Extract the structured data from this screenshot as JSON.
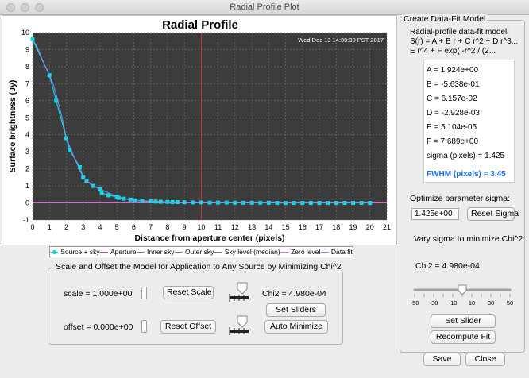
{
  "window": {
    "title": "Radial Profile Plot"
  },
  "chart_data": {
    "type": "scatter",
    "title": "Radial Profile",
    "timestamp": "Wed Dec 13 14:39:30 PST 2017",
    "xlabel": "Distance from aperture center (pixels)",
    "ylabel": "Surface brightness (Jy)",
    "xlim": [
      0,
      21
    ],
    "ylim": [
      -1,
      10
    ],
    "xticks": [
      "0",
      "1",
      "2",
      "3",
      "4",
      "5",
      "6",
      "7",
      "8",
      "9",
      "10",
      "11",
      "12",
      "13",
      "14",
      "15",
      "16",
      "17",
      "18",
      "19",
      "20",
      "21"
    ],
    "yticks": [
      "-1",
      "0",
      "1",
      "2",
      "3",
      "4",
      "5",
      "6",
      "7",
      "8",
      "9",
      "10"
    ],
    "aperture_x": 10,
    "zero_level": 0,
    "grid": true,
    "legend_position": "bottom",
    "series": [
      {
        "name": "Source + sky",
        "color": "#00e0e0",
        "x": [
          0.0,
          1.0,
          1.4,
          2.0,
          2.2,
          2.8,
          3.0,
          3.2,
          3.6,
          4.0,
          4.1,
          4.5,
          5.0,
          5.1,
          5.4,
          5.8,
          6.1,
          6.5,
          7.0,
          7.3,
          7.6,
          8.0,
          8.3,
          8.6,
          9.0,
          9.5,
          10.0,
          10.5,
          11.0,
          11.5,
          12.0,
          12.5,
          13.0,
          13.5,
          14.0,
          14.5,
          15.0,
          15.5,
          16.0,
          16.5,
          17.0,
          17.5,
          18.0,
          18.5,
          19.0,
          19.5,
          20.0
        ],
        "y": [
          9.6,
          7.5,
          6.0,
          3.8,
          3.1,
          2.1,
          1.5,
          1.3,
          1.0,
          0.82,
          0.6,
          0.45,
          0.37,
          0.3,
          0.25,
          0.2,
          0.15,
          0.12,
          0.1,
          0.08,
          0.07,
          0.06,
          0.05,
          0.05,
          0.04,
          0.03,
          0.03,
          0.02,
          0.02,
          0.02,
          0.01,
          0.01,
          0.01,
          0.01,
          0.01,
          0.0,
          0.0,
          0.0,
          0.0,
          0.0,
          0.0,
          0.0,
          0.0,
          0.0,
          0.0,
          0.0,
          0.0
        ]
      },
      {
        "name": "Data fit",
        "color": "#8a8aff",
        "x": [
          0.0,
          0.25,
          0.5,
          0.75,
          1.0,
          1.25,
          1.5,
          1.75,
          2.0,
          2.5,
          3.0,
          3.5,
          4.0,
          5.0,
          6.0,
          7.0,
          8.0,
          10.0,
          12.0,
          14.0,
          16.0,
          18.0,
          20.0
        ],
        "y": [
          9.6,
          9.2,
          8.6,
          8.0,
          7.5,
          6.9,
          6.0,
          5.0,
          3.8,
          2.6,
          1.5,
          1.05,
          0.82,
          0.37,
          0.15,
          0.1,
          0.06,
          0.03,
          0.01,
          0.01,
          0.0,
          0.0,
          0.0
        ]
      }
    ],
    "legend": [
      {
        "label": "Source + sky",
        "style": "dot-line",
        "color": "#00e0e0"
      },
      {
        "label": "Aperture",
        "style": "line",
        "color": "#e04040"
      },
      {
        "label": "Inner sky",
        "style": "line",
        "color": "#777777"
      },
      {
        "label": "Outer sky",
        "style": "line",
        "color": "#777777"
      },
      {
        "label": "Sky level (median)",
        "style": "line",
        "color": "#777777"
      },
      {
        "label": "Zero level",
        "style": "line",
        "color": "#e060e0"
      },
      {
        "label": "Data fit",
        "style": "line",
        "color": "#8a8aff"
      }
    ]
  },
  "scale_group": {
    "title": "Scale and Offset the Model for Application to Any Source by Minimizing Chi^2",
    "scale_label": "scale = 1.000e+00",
    "offset_label": "offset = 0.000e+00",
    "reset_scale": "Reset Scale",
    "reset_offset": "Reset Offset",
    "chi2": "Chi2 = 4.980e-04",
    "set_sliders": "Set Sliders",
    "auto_minimize": "Auto Minimize"
  },
  "fit_group": {
    "title": "Create Data-Fit Model",
    "model_line1": "Radial-profile data-fit model:",
    "model_line2": "S(r) = A + B r + C r^2 + D r^3...",
    "model_line3": "E r^4 + F exp( -r^2 / (2...",
    "params": [
      "A = 1.924e+00",
      "B = -5.638e-01",
      "C = 6.157e-02",
      "D = -2.928e-03",
      "E = 5.104e-05",
      "F = 7.689e+00"
    ],
    "sigma_text": "sigma (pixels) = 1.425",
    "fwhm_text": "FWHM (pixels) = 3.45",
    "optimize_label": "Optimize parameter sigma:",
    "sigma_value": "1.425e+00",
    "reset_sigma": "Reset Sigma",
    "vary_label": "Vary sigma to minimize Chi^2:",
    "chi2": "Chi2 = 4.980e-04",
    "slider_ticks": [
      "-50",
      "-30",
      "-10",
      "10",
      "30",
      "50"
    ],
    "slider_value": 0,
    "set_slider": "Set Slider",
    "recompute_fit": "Recompute Fit"
  },
  "bottom": {
    "save": "Save",
    "close": "Close"
  }
}
